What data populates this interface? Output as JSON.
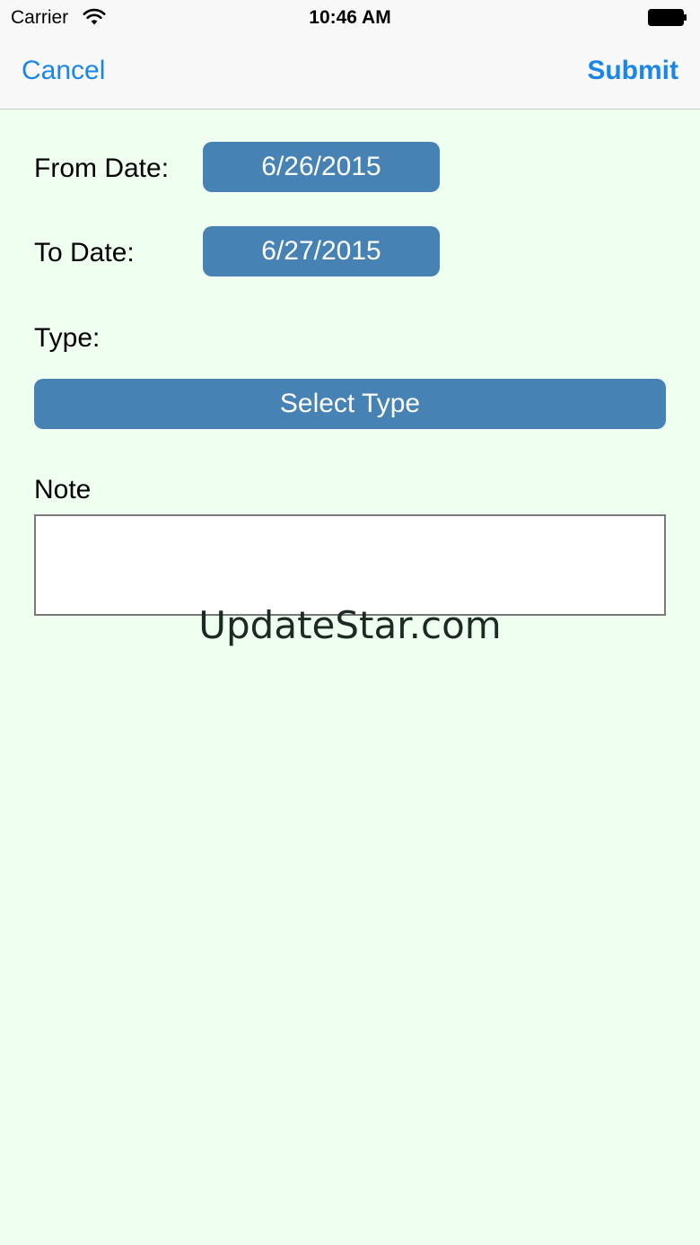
{
  "status_bar": {
    "carrier": "Carrier",
    "time": "10:46 AM",
    "wifi_icon": "wifi-icon",
    "battery_icon": "battery-icon"
  },
  "nav": {
    "cancel_label": "Cancel",
    "submit_label": "Submit"
  },
  "form": {
    "from_date_label": "From Date:",
    "from_date_value": "6/26/2015",
    "to_date_label": "To Date:",
    "to_date_value": "6/27/2015",
    "type_label": "Type:",
    "type_button_label": "Select Type",
    "note_label": "Note",
    "note_value": ""
  },
  "watermark": "UpdateStar.com",
  "colors": {
    "accent": "#1a86e8",
    "button_bg": "#4682b4",
    "background": "#effff0"
  }
}
